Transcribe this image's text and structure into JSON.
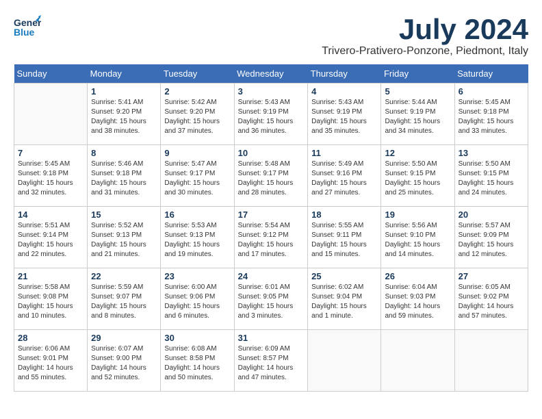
{
  "header": {
    "logo": {
      "general": "General",
      "blue": "Blue"
    },
    "title": "July 2024",
    "location": "Trivero-Prativero-Ponzone, Piedmont, Italy"
  },
  "calendar": {
    "weekdays": [
      "Sunday",
      "Monday",
      "Tuesday",
      "Wednesday",
      "Thursday",
      "Friday",
      "Saturday"
    ],
    "weeks": [
      [
        {
          "day": "",
          "info": ""
        },
        {
          "day": "1",
          "info": "Sunrise: 5:41 AM\nSunset: 9:20 PM\nDaylight: 15 hours\nand 38 minutes."
        },
        {
          "day": "2",
          "info": "Sunrise: 5:42 AM\nSunset: 9:20 PM\nDaylight: 15 hours\nand 37 minutes."
        },
        {
          "day": "3",
          "info": "Sunrise: 5:43 AM\nSunset: 9:19 PM\nDaylight: 15 hours\nand 36 minutes."
        },
        {
          "day": "4",
          "info": "Sunrise: 5:43 AM\nSunset: 9:19 PM\nDaylight: 15 hours\nand 35 minutes."
        },
        {
          "day": "5",
          "info": "Sunrise: 5:44 AM\nSunset: 9:19 PM\nDaylight: 15 hours\nand 34 minutes."
        },
        {
          "day": "6",
          "info": "Sunrise: 5:45 AM\nSunset: 9:18 PM\nDaylight: 15 hours\nand 33 minutes."
        }
      ],
      [
        {
          "day": "7",
          "info": "Sunrise: 5:45 AM\nSunset: 9:18 PM\nDaylight: 15 hours\nand 32 minutes."
        },
        {
          "day": "8",
          "info": "Sunrise: 5:46 AM\nSunset: 9:18 PM\nDaylight: 15 hours\nand 31 minutes."
        },
        {
          "day": "9",
          "info": "Sunrise: 5:47 AM\nSunset: 9:17 PM\nDaylight: 15 hours\nand 30 minutes."
        },
        {
          "day": "10",
          "info": "Sunrise: 5:48 AM\nSunset: 9:17 PM\nDaylight: 15 hours\nand 28 minutes."
        },
        {
          "day": "11",
          "info": "Sunrise: 5:49 AM\nSunset: 9:16 PM\nDaylight: 15 hours\nand 27 minutes."
        },
        {
          "day": "12",
          "info": "Sunrise: 5:50 AM\nSunset: 9:15 PM\nDaylight: 15 hours\nand 25 minutes."
        },
        {
          "day": "13",
          "info": "Sunrise: 5:50 AM\nSunset: 9:15 PM\nDaylight: 15 hours\nand 24 minutes."
        }
      ],
      [
        {
          "day": "14",
          "info": "Sunrise: 5:51 AM\nSunset: 9:14 PM\nDaylight: 15 hours\nand 22 minutes."
        },
        {
          "day": "15",
          "info": "Sunrise: 5:52 AM\nSunset: 9:13 PM\nDaylight: 15 hours\nand 21 minutes."
        },
        {
          "day": "16",
          "info": "Sunrise: 5:53 AM\nSunset: 9:13 PM\nDaylight: 15 hours\nand 19 minutes."
        },
        {
          "day": "17",
          "info": "Sunrise: 5:54 AM\nSunset: 9:12 PM\nDaylight: 15 hours\nand 17 minutes."
        },
        {
          "day": "18",
          "info": "Sunrise: 5:55 AM\nSunset: 9:11 PM\nDaylight: 15 hours\nand 15 minutes."
        },
        {
          "day": "19",
          "info": "Sunrise: 5:56 AM\nSunset: 9:10 PM\nDaylight: 15 hours\nand 14 minutes."
        },
        {
          "day": "20",
          "info": "Sunrise: 5:57 AM\nSunset: 9:09 PM\nDaylight: 15 hours\nand 12 minutes."
        }
      ],
      [
        {
          "day": "21",
          "info": "Sunrise: 5:58 AM\nSunset: 9:08 PM\nDaylight: 15 hours\nand 10 minutes."
        },
        {
          "day": "22",
          "info": "Sunrise: 5:59 AM\nSunset: 9:07 PM\nDaylight: 15 hours\nand 8 minutes."
        },
        {
          "day": "23",
          "info": "Sunrise: 6:00 AM\nSunset: 9:06 PM\nDaylight: 15 hours\nand 6 minutes."
        },
        {
          "day": "24",
          "info": "Sunrise: 6:01 AM\nSunset: 9:05 PM\nDaylight: 15 hours\nand 3 minutes."
        },
        {
          "day": "25",
          "info": "Sunrise: 6:02 AM\nSunset: 9:04 PM\nDaylight: 15 hours\nand 1 minute."
        },
        {
          "day": "26",
          "info": "Sunrise: 6:04 AM\nSunset: 9:03 PM\nDaylight: 14 hours\nand 59 minutes."
        },
        {
          "day": "27",
          "info": "Sunrise: 6:05 AM\nSunset: 9:02 PM\nDaylight: 14 hours\nand 57 minutes."
        }
      ],
      [
        {
          "day": "28",
          "info": "Sunrise: 6:06 AM\nSunset: 9:01 PM\nDaylight: 14 hours\nand 55 minutes."
        },
        {
          "day": "29",
          "info": "Sunrise: 6:07 AM\nSunset: 9:00 PM\nDaylight: 14 hours\nand 52 minutes."
        },
        {
          "day": "30",
          "info": "Sunrise: 6:08 AM\nSunset: 8:58 PM\nDaylight: 14 hours\nand 50 minutes."
        },
        {
          "day": "31",
          "info": "Sunrise: 6:09 AM\nSunset: 8:57 PM\nDaylight: 14 hours\nand 47 minutes."
        },
        {
          "day": "",
          "info": ""
        },
        {
          "day": "",
          "info": ""
        },
        {
          "day": "",
          "info": ""
        }
      ]
    ]
  }
}
